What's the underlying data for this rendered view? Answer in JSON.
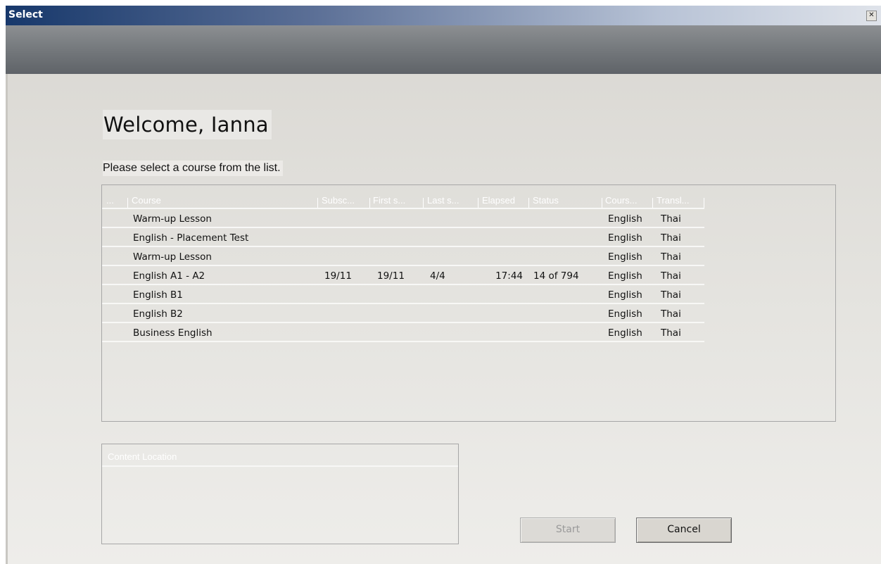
{
  "window": {
    "title": "Select",
    "close_glyph": "✕"
  },
  "welcome": "Welcome, Ianna",
  "prompt": "Please select a course from the list.",
  "course_list": {
    "columns": [
      "...",
      "Course",
      "Subsc...",
      "First s...",
      "Last s...",
      "Elapsed",
      "Status",
      "Cours...",
      "Transl..."
    ],
    "rows": [
      {
        "course": "Warm-up Lesson",
        "subscribed": "",
        "first": "",
        "last": "",
        "elapsed": "",
        "status": "",
        "course_lang": "English",
        "translation": "Thai"
      },
      {
        "course": "English - Placement Test",
        "subscribed": "",
        "first": "",
        "last": "",
        "elapsed": "",
        "status": "",
        "course_lang": "English",
        "translation": "Thai"
      },
      {
        "course": "Warm-up Lesson",
        "subscribed": "",
        "first": "",
        "last": "",
        "elapsed": "",
        "status": "",
        "course_lang": "English",
        "translation": "Thai"
      },
      {
        "course": "English A1 - A2",
        "subscribed": "19/11",
        "first": "19/11",
        "last": "4/4",
        "elapsed": "17:44",
        "status": "14 of 794",
        "course_lang": "English",
        "translation": "Thai"
      },
      {
        "course": "English B1",
        "subscribed": "",
        "first": "",
        "last": "",
        "elapsed": "",
        "status": "",
        "course_lang": "English",
        "translation": "Thai"
      },
      {
        "course": "English B2",
        "subscribed": "",
        "first": "",
        "last": "",
        "elapsed": "",
        "status": "",
        "course_lang": "English",
        "translation": "Thai"
      },
      {
        "course": "Business English",
        "subscribed": "",
        "first": "",
        "last": "",
        "elapsed": "",
        "status": "",
        "course_lang": "English",
        "translation": "Thai"
      }
    ]
  },
  "content_location": {
    "header": "Content Location"
  },
  "buttons": {
    "start": "Start",
    "cancel": "Cancel"
  },
  "colors": {
    "titlebar_start": "#17386b",
    "header_band": "#72767a",
    "window_bg": "#dcdad5"
  }
}
